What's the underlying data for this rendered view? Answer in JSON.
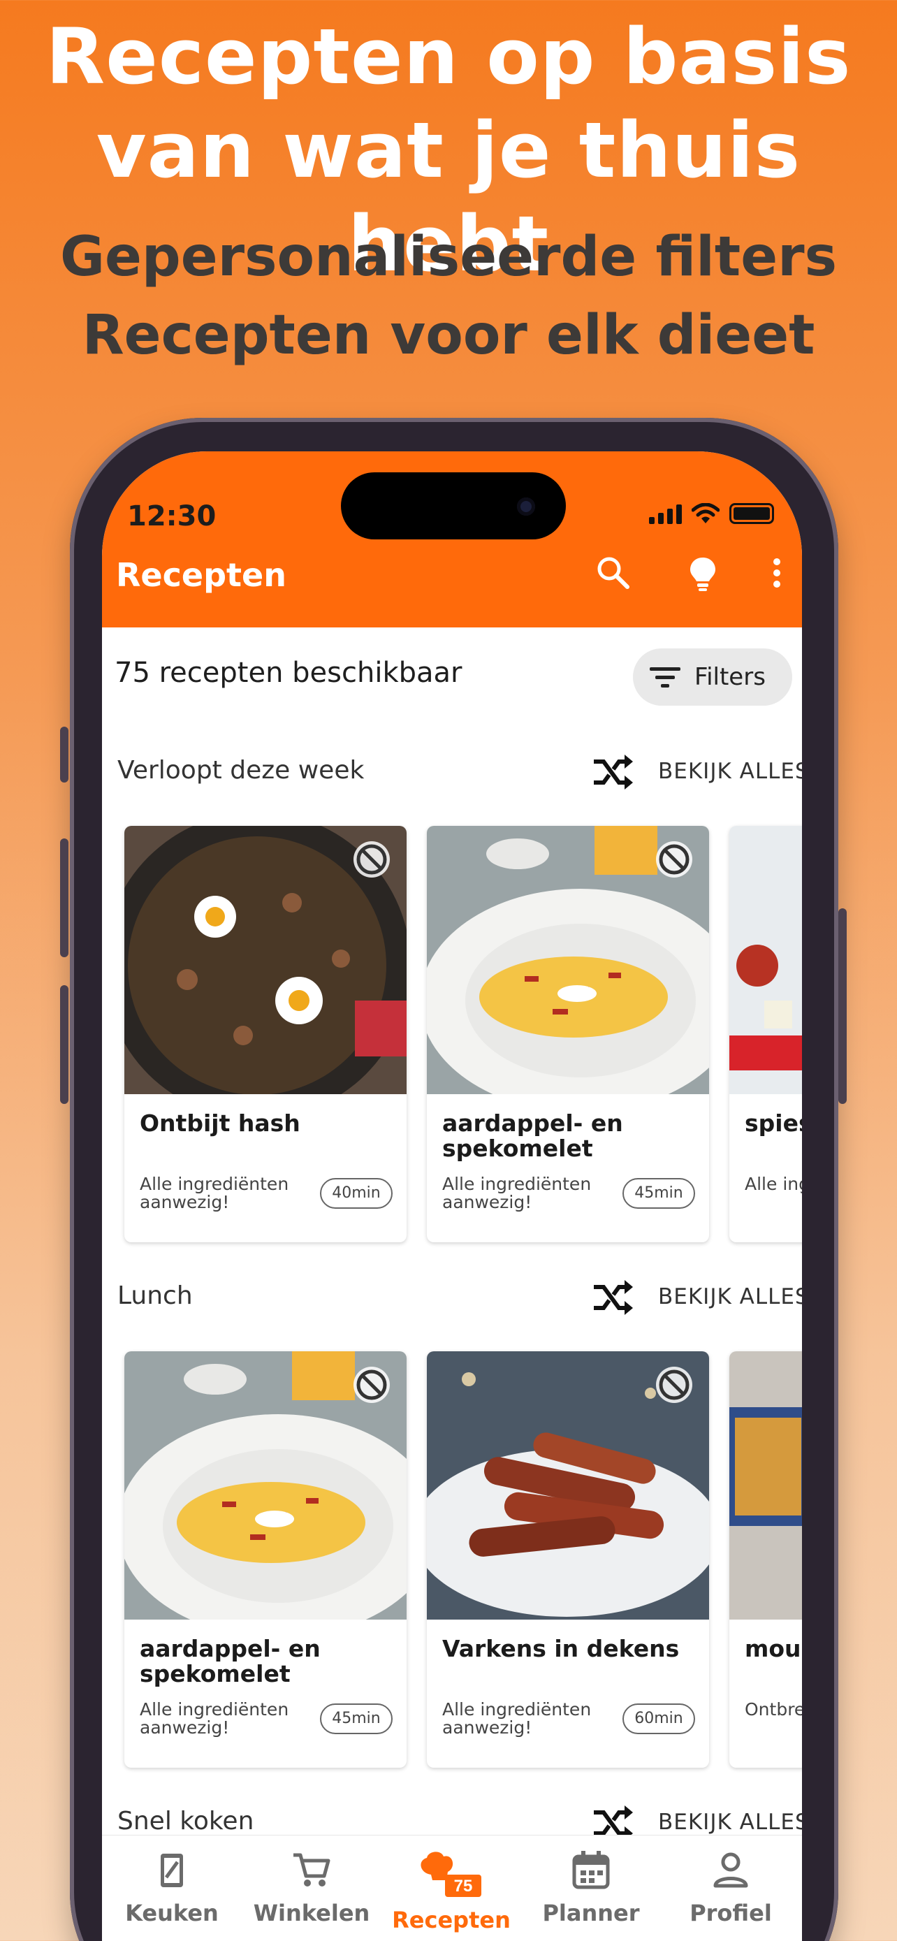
{
  "promo": {
    "headline_line1": "Recepten op basis",
    "headline_line2": "van wat je thuis hebt",
    "sub_line1": "Gepersonaliseerde filters",
    "sub_line2": "Recepten voor elk dieet"
  },
  "status_bar": {
    "time": "12:30"
  },
  "app_bar": {
    "title": "Recepten",
    "icons": [
      "search-icon",
      "lightbulb-icon",
      "more-vert-icon"
    ]
  },
  "summary": {
    "count_text": "75 recepten beschikbaar",
    "filters_label": "Filters"
  },
  "sections": [
    {
      "title": "Verloopt deze week",
      "see_all": "BEKIJK ALLES",
      "cards": [
        {
          "title": "Ontbijt hash",
          "availability": "Alle ingrediënten aanwezig!",
          "time": "40min"
        },
        {
          "title": "aardappel- en spekomelet",
          "availability": "Alle ingrediënten aanwezig!",
          "time": "45min"
        },
        {
          "title": "spies",
          "availability": "Alle ing",
          "time": ""
        }
      ]
    },
    {
      "title": "Lunch",
      "see_all": "BEKIJK ALLES",
      "cards": [
        {
          "title": "aardappel- en spekomelet",
          "availability": "Alle ingrediënten aanwezig!",
          "time": "45min"
        },
        {
          "title": "Varkens in dekens",
          "availability": "Alle ingrediënten aanwezig!",
          "time": "60min"
        },
        {
          "title": "mous",
          "availability": "Ontbre parmez",
          "time": ""
        }
      ]
    },
    {
      "title": "Snel koken",
      "see_all": "BEKIJK ALLES"
    }
  ],
  "bottom_nav": {
    "items": [
      {
        "label": "Keuken",
        "icon": "kitchen-icon"
      },
      {
        "label": "Winkelen",
        "icon": "cart-icon"
      },
      {
        "label": "Recepten",
        "icon": "recipes-icon",
        "badge": "75",
        "active": true
      },
      {
        "label": "Planner",
        "icon": "calendar-icon"
      },
      {
        "label": "Profiel",
        "icon": "profile-icon"
      }
    ]
  },
  "colors": {
    "accent": "#ff6a0b",
    "background_top": "#f57a1f",
    "background_bottom": "#f7d6b8"
  }
}
